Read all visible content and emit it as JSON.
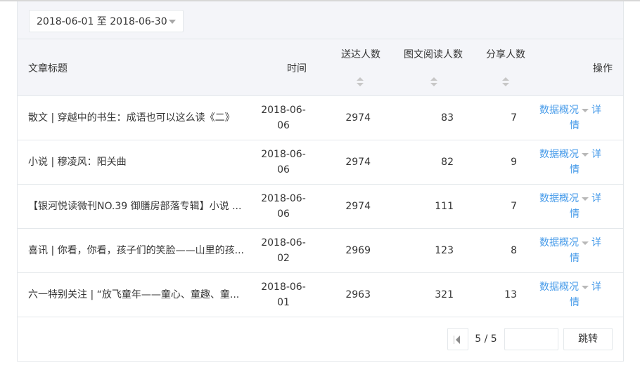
{
  "filter": {
    "date_range": "2018-06-01 至 2018-06-30"
  },
  "table": {
    "headers": {
      "title": "文章标题",
      "time": "时间",
      "delivered": "送达人数",
      "readers": "图文阅读人数",
      "shares": "分享人数",
      "actions": "操作"
    },
    "rows": [
      {
        "title": "散文 | 穿越中的书生：成语也可以这么读《二》",
        "date_a": "2018-06-",
        "date_b": "06",
        "delivered": "2974",
        "readers": "83",
        "shares": "7"
      },
      {
        "title": "小说 | 穆凌风：阳关曲",
        "date_a": "2018-06-",
        "date_b": "06",
        "delivered": "2974",
        "readers": "82",
        "shares": "9"
      },
      {
        "title": "【银河悦读微刊NO.39 御膳房部落专辑】小说 ...",
        "date_a": "2018-06-",
        "date_b": "06",
        "delivered": "2974",
        "readers": "111",
        "shares": "7"
      },
      {
        "title": "喜讯 | 你看，你看，孩子们的笑脸——山里的孩...",
        "date_a": "2018-06-",
        "date_b": "02",
        "delivered": "2969",
        "readers": "123",
        "shares": "8"
      },
      {
        "title": "六一特别关注 | “放飞童年——童心、童趣、童...",
        "date_a": "2018-06-",
        "date_b": "01",
        "delivered": "2963",
        "readers": "321",
        "shares": "13"
      }
    ],
    "actions": {
      "overview": "数据概况",
      "detail_a": "详",
      "detail_b": "情"
    }
  },
  "pagination": {
    "page_info": "5 / 5",
    "jump_input_value": "",
    "jump_label": "跳转"
  },
  "colors": {
    "link": "#459ae9",
    "header_bg": "#f4f5f9",
    "border": "#e4e8eb"
  }
}
